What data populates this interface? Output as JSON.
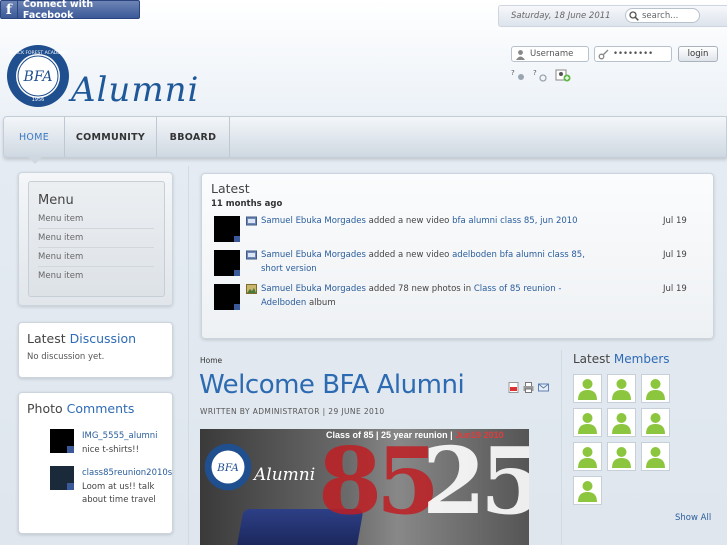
{
  "facebook": {
    "label": "Connect with Facebook",
    "icon": "facebook-f-icon"
  },
  "top_bar": {
    "date": "Saturday, 18 June 2011",
    "search_placeholder": "search..."
  },
  "login": {
    "username_placeholder": "Username",
    "password_value": "••••••••",
    "button": "login",
    "icons": [
      "forgot-username-icon",
      "forgot-password-icon",
      "register-icon"
    ]
  },
  "logo": {
    "wordmark": "Alumni",
    "seal_text": "BFA",
    "seal_ring": "BLACK FOREST ACADEMY",
    "seal_year": "1956"
  },
  "nav": {
    "items": [
      "HOME",
      "COMMUNITY",
      "BBOARD"
    ],
    "active": "HOME"
  },
  "menu": {
    "title": "Menu",
    "items": [
      "Menu item",
      "Menu item",
      "Menu item",
      "Menu item"
    ]
  },
  "discussion": {
    "title_plain": "Latest",
    "title_hl": "Discussion",
    "text": "No discussion yet."
  },
  "photo_comments": {
    "title_plain": "Photo",
    "title_hl": "Comments",
    "items": [
      {
        "name": "IMG_5555_alumni",
        "text": "nice t-shirts!!"
      },
      {
        "name": "class85reunion2010s",
        "text": "Loom at us!! talk about time travel"
      }
    ]
  },
  "latest": {
    "title": "Latest",
    "subtitle": "11 months ago",
    "items": [
      {
        "user": "Samuel Ebuka Morgades",
        "action": " added a new video ",
        "target": "bfa alumni class 85, jun 2010",
        "tail": "",
        "date": "Jul 19",
        "icon": "video-icon"
      },
      {
        "user": "Samuel Ebuka Morgades",
        "action": " added a new video ",
        "target": "adelboden bfa alumni class 85, short version",
        "tail": "",
        "date": "Jul 19",
        "icon": "video-icon"
      },
      {
        "user": "Samuel Ebuka Morgades",
        "action": " added 78 new photos in ",
        "target": "Class of 85 reunion - Adelboden",
        "tail": " album",
        "date": "Jul 19",
        "icon": "photo-icon"
      }
    ]
  },
  "article": {
    "breadcrumb": "Home",
    "title": "Welcome BFA Alumni",
    "meta": "WRITTEN BY ADMINISTRATOR | 29 JUNE 2010",
    "icons": [
      "pdf-icon",
      "print-icon",
      "email-icon"
    ],
    "hero": {
      "headline_white": "Class of 85 | 25 year reunion | ",
      "headline_red": "Jun19 2010",
      "big_left": "85",
      "big_right": "25",
      "wordmark": "Alumni"
    }
  },
  "members": {
    "title_plain": "Latest",
    "title_hl": "Members",
    "count": 10,
    "show_all": "Show All"
  },
  "colors": {
    "accent": "#2e6bb5",
    "facebook": "#3b5998",
    "member_green": "#8cc63f"
  }
}
